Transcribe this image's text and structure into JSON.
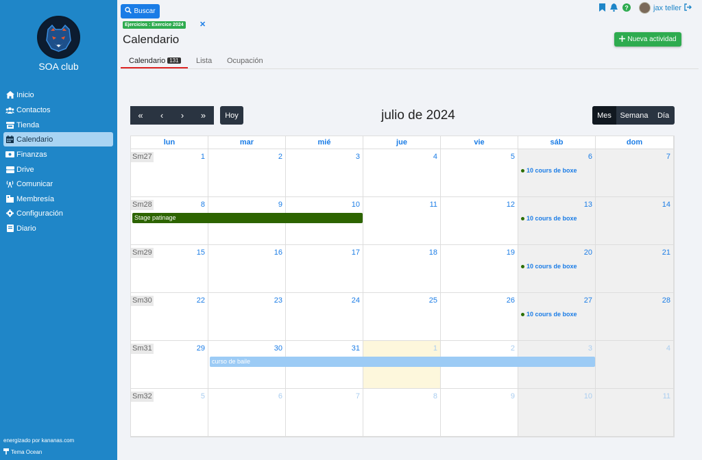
{
  "sidebar": {
    "club_name": "SOA club",
    "items": [
      {
        "label": "Inicio",
        "icon": "home-icon"
      },
      {
        "label": "Contactos",
        "icon": "users-icon"
      },
      {
        "label": "Tienda",
        "icon": "store-icon"
      },
      {
        "label": "Calendario",
        "icon": "calendar-icon",
        "active": true
      },
      {
        "label": "Finanzas",
        "icon": "money-icon"
      },
      {
        "label": "Drive",
        "icon": "drive-icon"
      },
      {
        "label": "Comunicar",
        "icon": "broadcast-icon"
      },
      {
        "label": "Membresía",
        "icon": "membership-icon"
      },
      {
        "label": "Configuración",
        "icon": "gear-icon"
      },
      {
        "label": "Diario",
        "icon": "journal-icon"
      }
    ],
    "powered_by": "energizado por kananas.com",
    "theme": "Tema Ocean"
  },
  "header": {
    "search_label": "Buscar",
    "user_name": "jax teller",
    "filter_tag": "Ejercicios : Exercice 2024",
    "page_title": "Calendario",
    "new_button_label": "Nueva actividad"
  },
  "tabs": [
    {
      "label": "Calendario",
      "count": "131",
      "active": true
    },
    {
      "label": "Lista"
    },
    {
      "label": "Ocupación"
    }
  ],
  "toolbar": {
    "today_label": "Hoy",
    "month_title": "julio de 2024",
    "views": [
      "Mes",
      "Semana",
      "Día"
    ],
    "active_view": "Mes"
  },
  "calendar": {
    "day_headers": [
      "lun",
      "mar",
      "mié",
      "jue",
      "vie",
      "sáb",
      "dom"
    ],
    "weeks": [
      {
        "label": "Sm27",
        "days": [
          1,
          2,
          3,
          4,
          5,
          6,
          7
        ]
      },
      {
        "label": "Sm28",
        "days": [
          8,
          9,
          10,
          11,
          12,
          13,
          14
        ]
      },
      {
        "label": "Sm29",
        "days": [
          15,
          16,
          17,
          18,
          19,
          20,
          21
        ]
      },
      {
        "label": "Sm30",
        "days": [
          22,
          23,
          24,
          25,
          26,
          27,
          28
        ]
      },
      {
        "label": "Sm31",
        "days": [
          29,
          30,
          31,
          1,
          2,
          3,
          4
        ]
      },
      {
        "label": "Sm32",
        "days": [
          5,
          6,
          7,
          8,
          9,
          10,
          11
        ]
      }
    ],
    "events": {
      "boxe": "10 cours de boxe",
      "patinage": "Stage patinage",
      "baile": "curso de baile"
    },
    "colors": {
      "patinage": "#2d6400",
      "baile": "#9ccbf5",
      "weekend_bg": "#f0f0f0",
      "today_bg": "#fdf7dc"
    }
  }
}
